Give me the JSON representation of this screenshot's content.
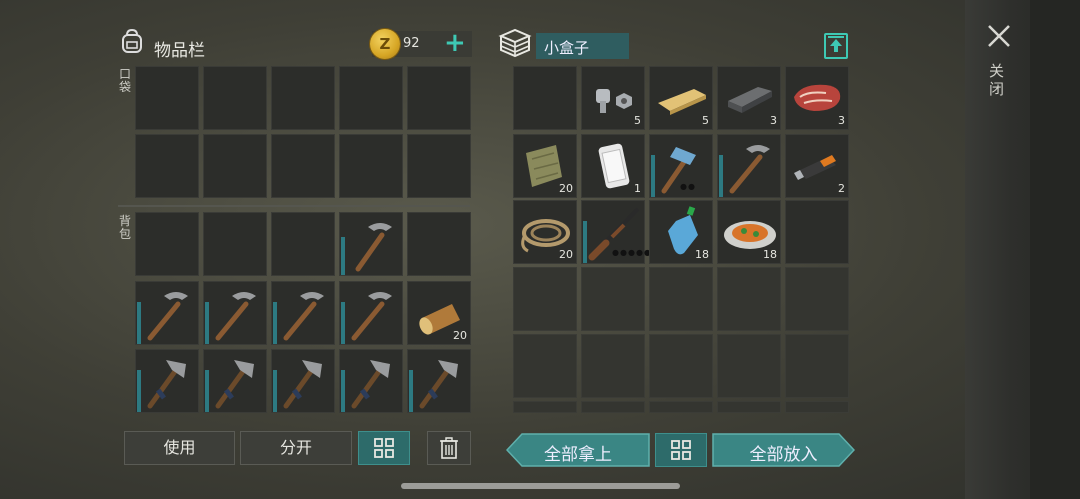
{
  "inventory": {
    "title": "物品栏",
    "coins": "92",
    "coin_symbol": "Z",
    "pocket_label": "口袋",
    "backpack_label": "背包",
    "backpack": [
      {
        "item": "",
        "qty": ""
      },
      {
        "item": "",
        "qty": ""
      },
      {
        "item": "",
        "qty": ""
      },
      {
        "item": "pickaxe-icon",
        "qty": ""
      },
      {
        "item": "",
        "qty": ""
      },
      {
        "item": "pickaxe-icon",
        "qty": ""
      },
      {
        "item": "pickaxe-icon",
        "qty": ""
      },
      {
        "item": "pickaxe-icon",
        "qty": ""
      },
      {
        "item": "pickaxe-icon",
        "qty": ""
      },
      {
        "item": "log-icon",
        "qty": "20"
      },
      {
        "item": "hatchet-icon",
        "qty": ""
      },
      {
        "item": "hatchet-icon",
        "qty": ""
      },
      {
        "item": "hatchet-icon",
        "qty": ""
      },
      {
        "item": "hatchet-icon",
        "qty": ""
      },
      {
        "item": "hatchet-icon",
        "qty": ""
      }
    ]
  },
  "container": {
    "title": "小盒子",
    "items": [
      {
        "item": "",
        "qty": ""
      },
      {
        "item": "nuts-bolts-icon",
        "qty": "5"
      },
      {
        "item": "wooden-plank-icon",
        "qty": "5"
      },
      {
        "item": "iron-ingot-icon",
        "qty": "3"
      },
      {
        "item": "raw-meat-icon",
        "qty": "3"
      },
      {
        "item": "cloth-icon",
        "qty": "20"
      },
      {
        "item": "smartphone-icon",
        "qty": "1"
      },
      {
        "item": "hammer-icon",
        "qty": ""
      },
      {
        "item": "pickaxe-icon",
        "qty": ""
      },
      {
        "item": "usb-drive-icon",
        "qty": "2"
      },
      {
        "item": "rope-icon",
        "qty": "20"
      },
      {
        "item": "shotgun-icon",
        "qty": ""
      },
      {
        "item": "water-bottle-icon",
        "qty": "18"
      },
      {
        "item": "food-plate-icon",
        "qty": "18"
      },
      {
        "item": "",
        "qty": ""
      }
    ]
  },
  "buttons": {
    "use": "使用",
    "split": "分开",
    "take_all": "全部拿上",
    "put_all": "全部放入"
  },
  "close_label": "关闭",
  "colors": {
    "accent": "#3ec9b4",
    "teal_button": "#2d6b6a",
    "durability": "#2d7a82"
  }
}
